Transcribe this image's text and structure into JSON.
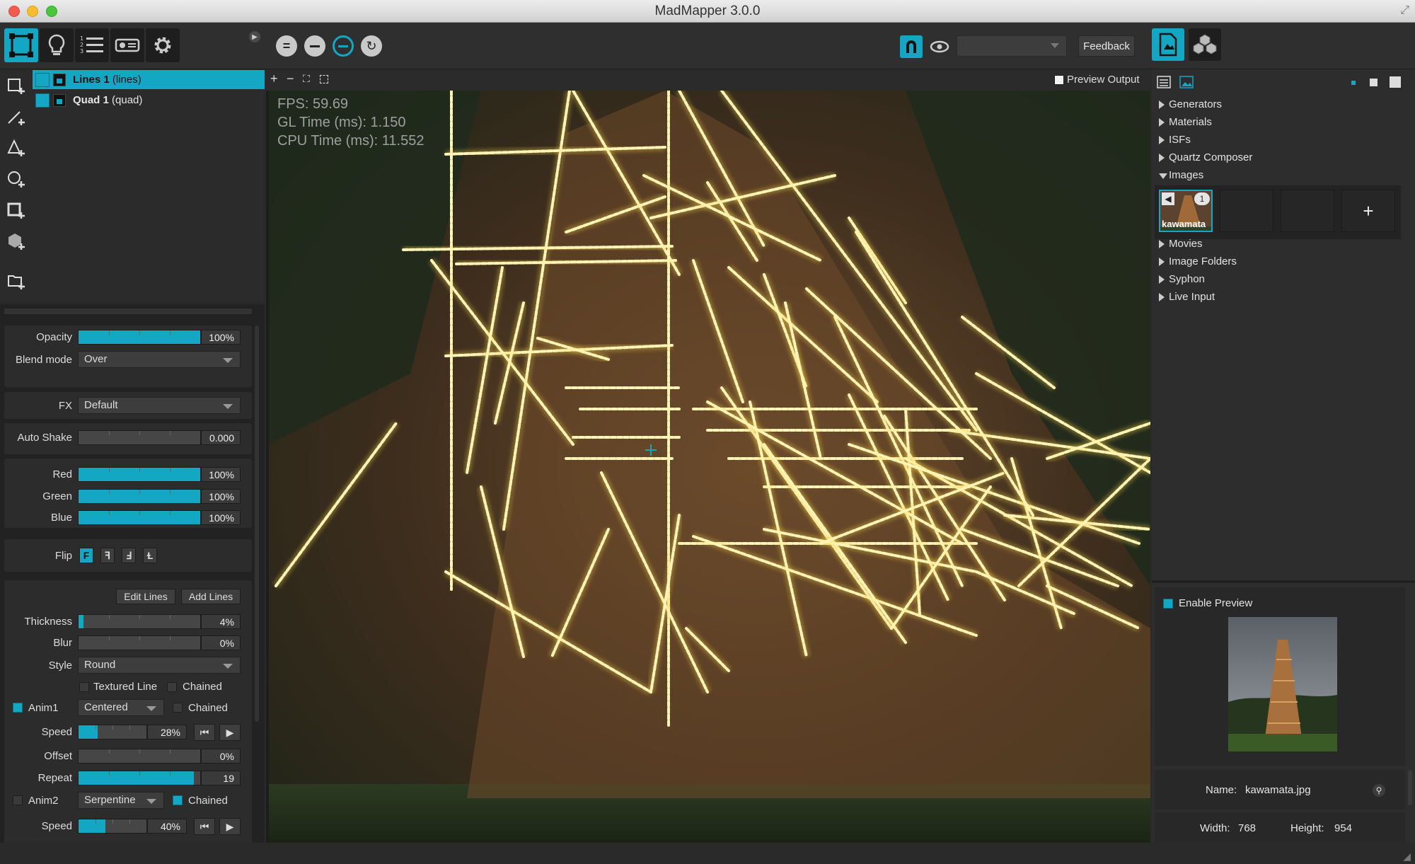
{
  "window": {
    "title": "MadMapper 3.0.0"
  },
  "toolbar": {
    "feedback_label": "Feedback",
    "icons": [
      "surface-icon",
      "lightbulb-icon",
      "list-icon",
      "projector-icon",
      "gear-icon",
      "expand-arrow-icon",
      "equal-icon",
      "minus-icon",
      "minus-circle-icon",
      "rotate-icon",
      "magnet-icon",
      "eye-icon",
      "document-icon",
      "cubes-icon"
    ]
  },
  "layers": [
    {
      "name": "Lines 1",
      "type": "(lines)",
      "selected": true
    },
    {
      "name": "Quad 1",
      "type": "(quad)",
      "selected": false
    }
  ],
  "properties": {
    "opacity": {
      "label": "Opacity",
      "value": "100%",
      "level": 1.0
    },
    "blend_mode": {
      "label": "Blend mode",
      "value": "Over"
    },
    "fx": {
      "label": "FX",
      "value": "Default"
    },
    "auto_shake": {
      "label": "Auto Shake",
      "value": "0.000",
      "level": 0.0
    },
    "red": {
      "label": "Red",
      "value": "100%",
      "level": 1.0
    },
    "green": {
      "label": "Green",
      "value": "100%",
      "level": 1.0
    },
    "blue": {
      "label": "Blue",
      "value": "100%",
      "level": 1.0
    },
    "flip": {
      "label": "Flip",
      "buttons": [
        "F",
        "ꟻ",
        "Ⅎ",
        "Ɫ"
      ]
    },
    "edit_lines_label": "Edit Lines",
    "add_lines_label": "Add Lines",
    "thickness": {
      "label": "Thickness",
      "value": "4%",
      "level": 0.04
    },
    "blur": {
      "label": "Blur",
      "value": "0%",
      "level": 0.0
    },
    "style": {
      "label": "Style",
      "value": "Round"
    },
    "textured_line_label": "Textured Line",
    "chained_label": "Chained",
    "anim1": {
      "label": "Anim1",
      "mode": "Centered",
      "chained_label": "Chained",
      "checked": true
    },
    "speed1": {
      "label": "Speed",
      "value": "28%",
      "level": 0.28
    },
    "offset": {
      "label": "Offset",
      "value": "0%",
      "level": 0.0
    },
    "repeat": {
      "label": "Repeat",
      "value": "19",
      "level": 0.95
    },
    "anim2": {
      "label": "Anim2",
      "mode": "Serpentine",
      "chained_label": "Chained",
      "checked": false
    },
    "speed2": {
      "label": "Speed",
      "value": "40%",
      "level": 0.4
    }
  },
  "canvas": {
    "preview_output_label": "Preview Output",
    "fps": "FPS: 59.69",
    "gl_time": "GL Time (ms): 1.150",
    "cpu_time": "CPU Time (ms): 11.552"
  },
  "library": {
    "items": [
      "Generators",
      "Materials",
      "ISFs",
      "Quartz Composer"
    ],
    "images_label": "Images",
    "image_name": "kawamata",
    "image_badge": "1",
    "add_label": "+",
    "items_after": [
      "Movies",
      "Image Folders",
      "Syphon",
      "Live Input"
    ]
  },
  "preview": {
    "enable_label": "Enable Preview",
    "name_label": "Name:",
    "name_value": "kawamata.jpg",
    "width_label": "Width:",
    "width_value": "768",
    "height_label": "Height:",
    "height_value": "954"
  },
  "colors": {
    "accent": "#13a7c4",
    "line": "#f3d34a"
  }
}
